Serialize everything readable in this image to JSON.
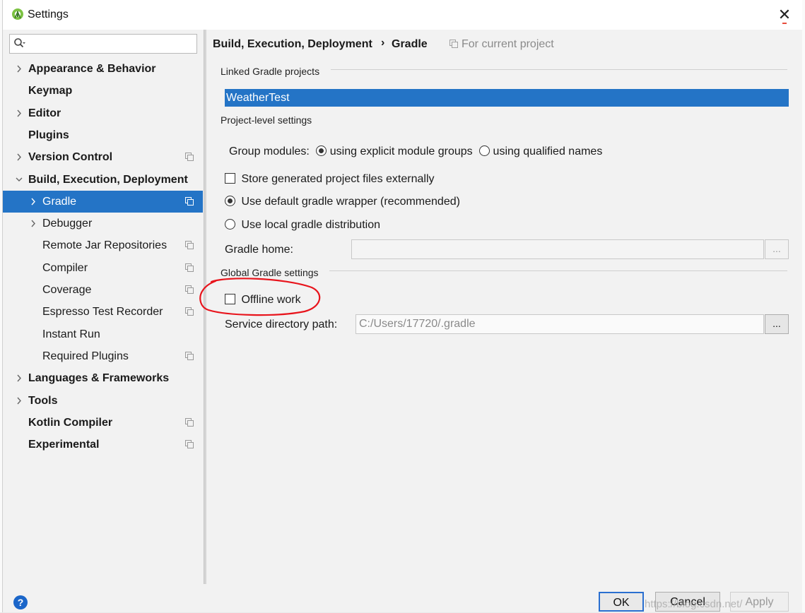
{
  "window": {
    "title": "Settings",
    "close_glyph": "✕"
  },
  "search": {
    "placeholder": ""
  },
  "tree": [
    {
      "label": "Appearance & Behavior",
      "bold": true,
      "arrow": "right",
      "level": 0,
      "proj": false
    },
    {
      "label": "Keymap",
      "bold": true,
      "arrow": "none",
      "level": 0,
      "proj": false
    },
    {
      "label": "Editor",
      "bold": true,
      "arrow": "right",
      "level": 0,
      "proj": false
    },
    {
      "label": "Plugins",
      "bold": true,
      "arrow": "none",
      "level": 0,
      "proj": false
    },
    {
      "label": "Version Control",
      "bold": true,
      "arrow": "right",
      "level": 0,
      "proj": true
    },
    {
      "label": "Build, Execution, Deployment",
      "bold": true,
      "arrow": "down",
      "level": 0,
      "proj": false
    },
    {
      "label": "Gradle",
      "bold": false,
      "arrow": "right",
      "level": 1,
      "proj": true,
      "selected": true
    },
    {
      "label": "Debugger",
      "bold": false,
      "arrow": "right",
      "level": 1,
      "proj": false
    },
    {
      "label": "Remote Jar Repositories",
      "bold": false,
      "arrow": "none",
      "level": 1,
      "proj": true
    },
    {
      "label": "Compiler",
      "bold": false,
      "arrow": "none",
      "level": 1,
      "proj": true
    },
    {
      "label": "Coverage",
      "bold": false,
      "arrow": "none",
      "level": 1,
      "proj": true
    },
    {
      "label": "Espresso Test Recorder",
      "bold": false,
      "arrow": "none",
      "level": 1,
      "proj": true
    },
    {
      "label": "Instant Run",
      "bold": false,
      "arrow": "none",
      "level": 1,
      "proj": false
    },
    {
      "label": "Required Plugins",
      "bold": false,
      "arrow": "none",
      "level": 1,
      "proj": true
    },
    {
      "label": "Languages & Frameworks",
      "bold": true,
      "arrow": "right",
      "level": 0,
      "proj": false
    },
    {
      "label": "Tools",
      "bold": true,
      "arrow": "right",
      "level": 0,
      "proj": false
    },
    {
      "label": "Kotlin Compiler",
      "bold": true,
      "arrow": "none",
      "level": 0,
      "proj": true
    },
    {
      "label": "Experimental",
      "bold": true,
      "arrow": "none",
      "level": 0,
      "proj": true
    }
  ],
  "breadcrumb": {
    "parent": "Build, Execution, Deployment",
    "separator": "›",
    "current": "Gradle",
    "scope": "For current project"
  },
  "linked": {
    "heading": "Linked Gradle projects",
    "projects": [
      "WeatherTest"
    ]
  },
  "project_level": {
    "heading": "Project-level settings",
    "group_modules_label": "Group modules:",
    "option_explicit": "using explicit module groups",
    "option_qualified": "using qualified names",
    "group_modules_selected": "explicit",
    "store_generated_label": "Store generated project files externally",
    "store_generated_checked": false,
    "use_wrapper_label": "Use default gradle wrapper (recommended)",
    "use_local_label": "Use local gradle distribution",
    "distribution_selected": "wrapper",
    "gradle_home_label": "Gradle home:",
    "gradle_home_value": "",
    "browse_label": "..."
  },
  "global": {
    "heading": "Global Gradle settings",
    "offline_label": "Offline work",
    "offline_checked": false,
    "service_dir_label": "Service directory path:",
    "service_dir_value": "C:/Users/17720/.gradle",
    "browse_label": "..."
  },
  "footer": {
    "help_label": "?",
    "ok_label": "OK",
    "cancel_label": "Cancel",
    "apply_label": "Apply",
    "watermark": "https://blog.csdn.net/"
  },
  "colors": {
    "selection": "#2474c6",
    "annotation_ink": "#e8141c",
    "help": "#1b66c9"
  }
}
